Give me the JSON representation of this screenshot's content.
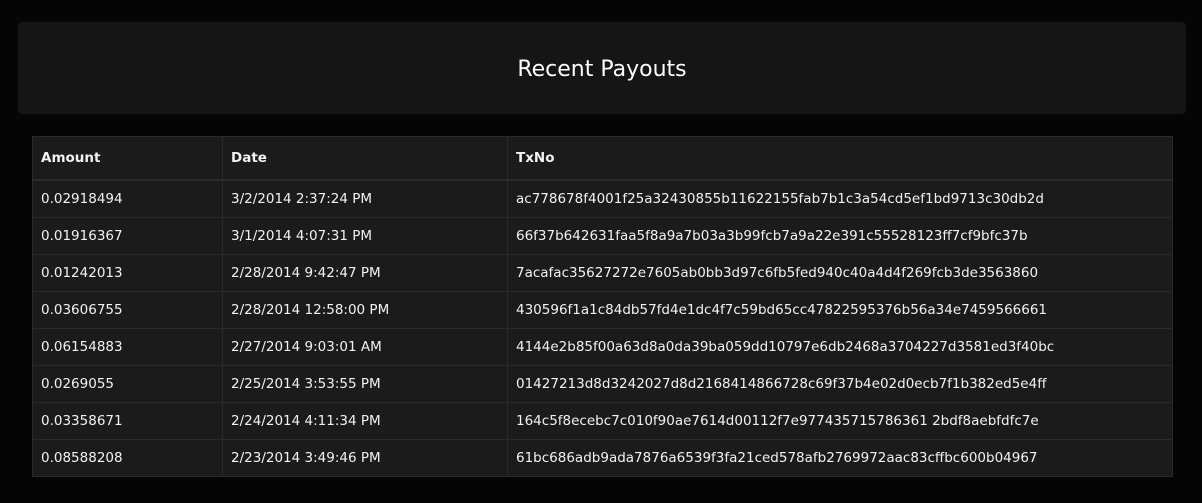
{
  "header": {
    "title": "Recent Payouts"
  },
  "table": {
    "columns": [
      "Amount",
      "Date",
      "TxNo"
    ],
    "rows": [
      {
        "amount": "0.02918494",
        "date": "3/2/2014 2:37:24 PM",
        "txno": "ac778678f4001f25a32430855b11622155fab7b1c3a54cd5ef1bd9713c30db2d"
      },
      {
        "amount": "0.01916367",
        "date": "3/1/2014 4:07:31 PM",
        "txno": "66f37b642631faa5f8a9a7b03a3b99fcb7a9a22e391c55528123ff7cf9bfc37b"
      },
      {
        "amount": "0.01242013",
        "date": "2/28/2014 9:42:47 PM",
        "txno": "7acafac35627272e7605ab0bb3d97c6fb5fed940c40a4d4f269fcb3de3563860"
      },
      {
        "amount": "0.03606755",
        "date": "2/28/2014 12:58:00 PM",
        "txno": "430596f1a1c84db57fd4e1dc4f7c59bd65cc47822595376b56a34e7459566661"
      },
      {
        "amount": "0.06154883",
        "date": "2/27/2014 9:03:01 AM",
        "txno": "4144e2b85f00a63d8a0da39ba059dd10797e6db2468a3704227d3581ed3f40bc"
      },
      {
        "amount": "0.0269055",
        "date": "2/25/2014 3:53:55 PM",
        "txno": "01427213d8d3242027d8d2168414866728c69f37b4e02d0ecb7f1b382ed5e4ff"
      },
      {
        "amount": "0.03358671",
        "date": "2/24/2014 4:11:34 PM",
        "txno": "164c5f8ecebc7c010f90ae7614d00112f7e977435715786361 2bdf8aebfdfc7e"
      },
      {
        "amount": "0.08588208",
        "date": "2/23/2014 3:49:46 PM",
        "txno": "61bc686adb9ada7876a6539f3fa21ced578afb2769972aac83cffbc600b04967"
      }
    ]
  }
}
